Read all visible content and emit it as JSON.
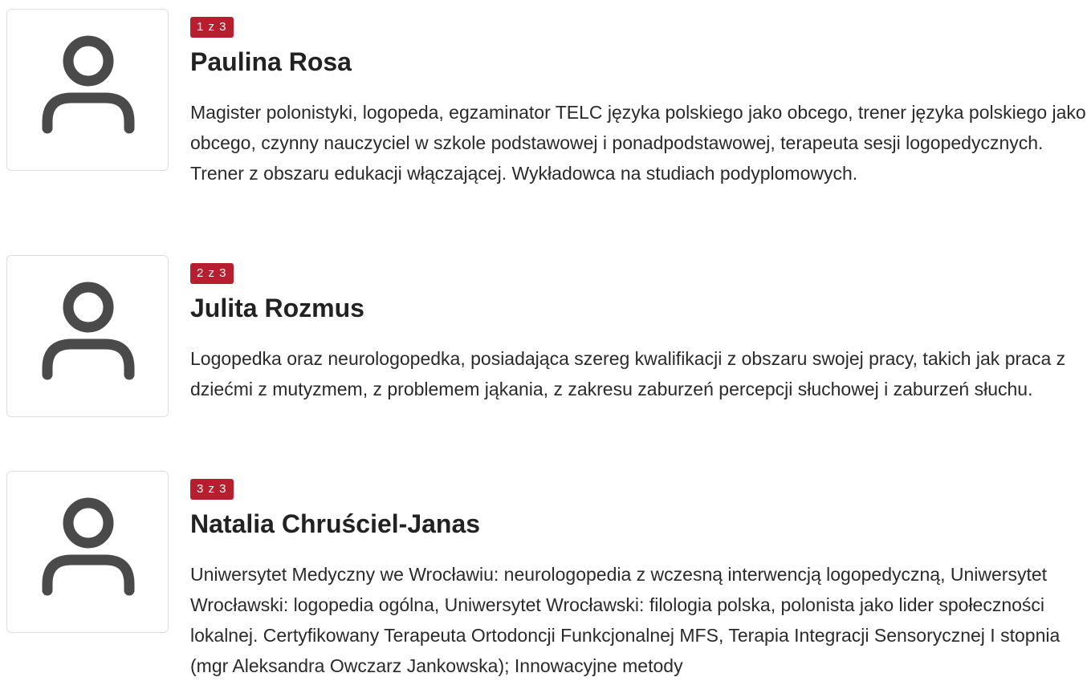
{
  "people": [
    {
      "counter": "1 z 3",
      "name": "Paulina Rosa",
      "bio": "Magister polonistyki, logopeda, egzaminator TELC języka polskiego jako obcego, trener języka polskiego jako obcego, czynny nauczyciel w szkole podstawowej i ponadpodstawowej, terapeuta sesji logopedycznych. Trener z obszaru edukacji włączającej. Wykładowca na studiach podyplomowych.",
      "avatar_icon": "user-icon"
    },
    {
      "counter": "2 z 3",
      "name": "Julita Rozmus",
      "bio": "Logopedka oraz neurologopedka, posiadająca szereg kwalifikacji z obszaru swojej pracy, takich jak praca z dziećmi z mutyzmem, z problemem jąkania, z zakresu zaburzeń percepcji słuchowej i zaburzeń słuchu.",
      "avatar_icon": "user-icon"
    },
    {
      "counter": "3 z 3",
      "name": "Natalia Chruściel-Janas",
      "bio": "Uniwersytet Medyczny we Wrocławiu: neurologopedia z wczesną interwencją logopedyczną, Uniwersytet Wrocławski: logopedia ogólna, Uniwersytet Wrocławski: filologia polska, polonista jako lider społeczności lokalnej. Certyfikowany Terapeuta Ortodoncji Funkcjonalnej MFS, Terapia Integracji Sensorycznej I stopnia (mgr Aleksandra Owczarz Jankowska); Innowacyjne metody",
      "avatar_icon": "user-icon"
    }
  ],
  "colors": {
    "badge_bg": "#b81f2e",
    "badge_text": "#ffffff",
    "icon": "#4a4a4a",
    "avatar_border": "#dedede"
  }
}
